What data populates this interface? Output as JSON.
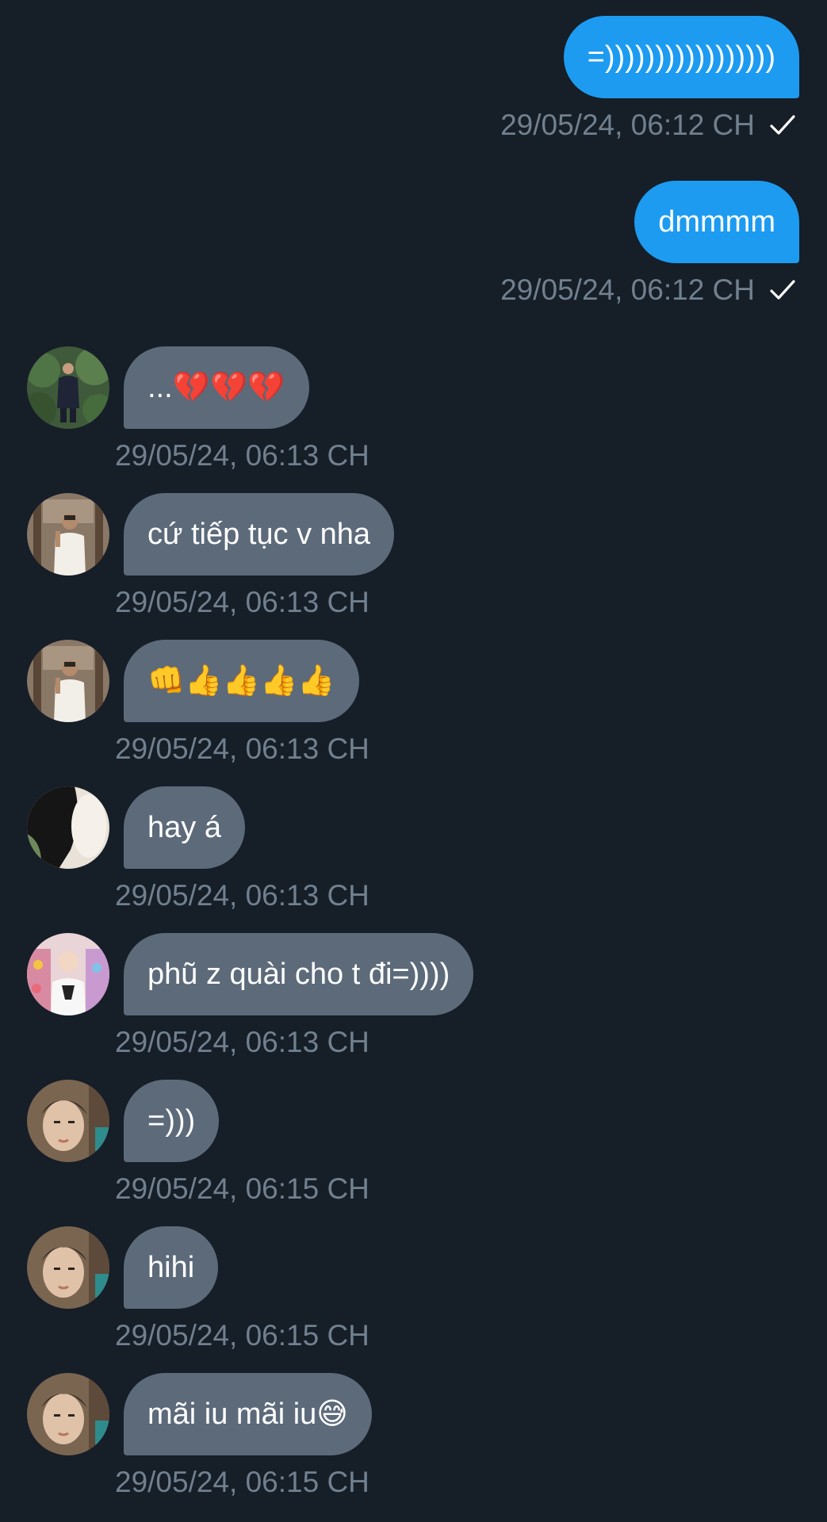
{
  "sent": [
    {
      "text": "=)))))))))))))))))",
      "time": "29/05/24, 06:12 CH"
    },
    {
      "text": "dmmmm",
      "time": "29/05/24, 06:12 CH"
    }
  ],
  "received": [
    {
      "text": "...💔💔💔",
      "time": "29/05/24, 06:13 CH",
      "avatar": "person-outdoors-avatar"
    },
    {
      "text": "cứ tiếp tục v nha",
      "time": "29/05/24, 06:13 CH",
      "avatar": "mirror-selfie-avatar"
    },
    {
      "text": "👊👍👍👍👍",
      "time": "29/05/24, 06:13 CH",
      "avatar": "mirror-selfie-avatar"
    },
    {
      "text": "hay á",
      "time": "29/05/24, 06:13 CH",
      "avatar": "dark-photo-avatar"
    },
    {
      "text": "phũ z quài cho t đi=))))",
      "time": "29/05/24, 06:13 CH",
      "avatar": "colorful-shelf-avatar"
    },
    {
      "text": "=)))",
      "time": "29/05/24, 06:15 CH",
      "avatar": "portrait-avatar"
    },
    {
      "text": "hihi",
      "time": "29/05/24, 06:15 CH",
      "avatar": "portrait-avatar"
    },
    {
      "text": "mãi iu mãi iu😅",
      "time": "29/05/24, 06:15 CH",
      "avatar": "portrait-avatar"
    }
  ],
  "colors": {
    "background": "#161e28",
    "sent_bubble": "#1d9bf0",
    "received_bubble": "#5c6a7a",
    "timestamp": "#71808f"
  },
  "icons": {
    "read_receipt": "checkmark-icon"
  }
}
